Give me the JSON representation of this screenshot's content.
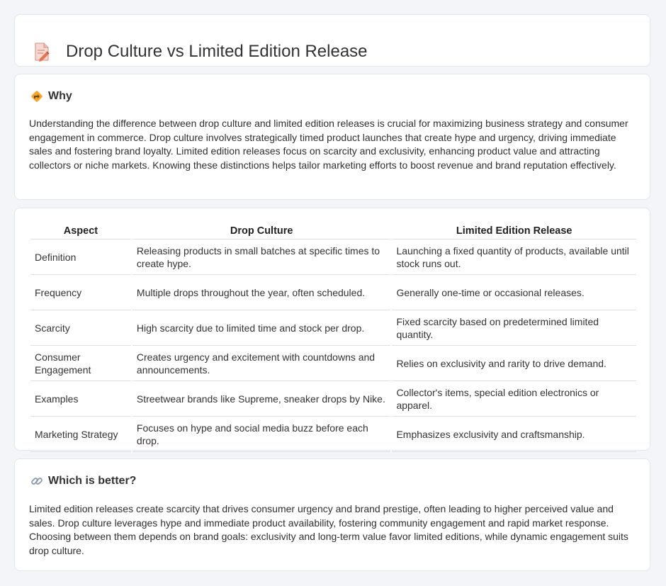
{
  "header": {
    "title": "Drop Culture vs Limited Edition Release",
    "icon": "document-pencil-icon"
  },
  "why": {
    "title": "Why",
    "icon": "diamond-direction-icon",
    "text": "Understanding the difference between drop culture and limited edition releases is crucial for maximizing business strategy and consumer engagement in commerce. Drop culture involves strategically timed product launches that create hype and urgency, driving immediate sales and fostering brand loyalty. Limited edition releases focus on scarcity and exclusivity, enhancing product value and attracting collectors or niche markets. Knowing these distinctions helps tailor marketing efforts to boost revenue and brand reputation effectively."
  },
  "table": {
    "headers": [
      "Aspect",
      "Drop Culture",
      "Limited Edition Release"
    ],
    "rows": [
      [
        "Definition",
        "Releasing products in small batches at specific times to create hype.",
        "Launching a fixed quantity of products, available until stock runs out."
      ],
      [
        "Frequency",
        "Multiple drops throughout the year, often scheduled.",
        "Generally one-time or occasional releases."
      ],
      [
        "Scarcity",
        "High scarcity due to limited time and stock per drop.",
        "Fixed scarcity based on predetermined limited quantity."
      ],
      [
        "Consumer Engagement",
        "Creates urgency and excitement with countdowns and announcements.",
        "Relies on exclusivity and rarity to drive demand."
      ],
      [
        "Examples",
        "Streetwear brands like Supreme, sneaker drops by Nike.",
        "Collector's items, special edition electronics or apparel."
      ],
      [
        "Marketing Strategy",
        "Focuses on hype and social media buzz before each drop.",
        "Emphasizes exclusivity and craftsmanship."
      ]
    ]
  },
  "better": {
    "title": "Which is better?",
    "icon": "link-icon",
    "text": "Limited edition releases create scarcity that drives consumer urgency and brand prestige, often leading to higher perceived value and sales. Drop culture leverages hype and immediate product availability, fostering community engagement and rapid market response. Choosing between them depends on brand goals: exclusivity and long-term value favor limited editions, while dynamic engagement suits drop culture."
  }
}
